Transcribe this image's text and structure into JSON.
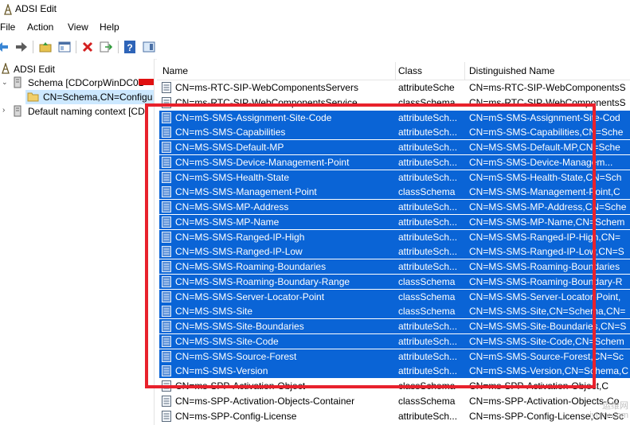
{
  "window": {
    "title": "ADSI Edit"
  },
  "menu": {
    "items": [
      "File",
      "Action",
      "View",
      "Help"
    ]
  },
  "tree": {
    "root": "ADSI Edit",
    "schema": "Schema [CDCorpWinDC01",
    "schema_child": "CN=Schema,CN=Configu",
    "default_context": "Default naming context [CD"
  },
  "list": {
    "columns": [
      "Name",
      "Class",
      "Distinguished Name"
    ],
    "rows": [
      {
        "name": "CN=ms-RTC-SIP-WebComponentsServers",
        "class": "attributeSche",
        "dn": "CN=ms-RTC-SIP-WebComponentsS"
      },
      {
        "name": "CN=ms-RTC-SIP-WebComponentsService",
        "class": "classSchema",
        "dn": "CN=ms-RTC-SIP-WebComponentsS"
      },
      {
        "name": "CN=mS-SMS-Assignment-Site-Code",
        "class": "attributeSch...",
        "dn": "CN=mS-SMS-Assignment-Site-Cod"
      },
      {
        "name": "CN=mS-SMS-Capabilities",
        "class": "attributeSch...",
        "dn": "CN=mS-SMS-Capabilities,CN=Sche"
      },
      {
        "name": "CN=MS-SMS-Default-MP",
        "class": "attributeSch...",
        "dn": "CN=MS-SMS-Default-MP,CN=Sche"
      },
      {
        "name": "CN=mS-SMS-Device-Management-Point",
        "class": "attributeSch...",
        "dn": "CN=mS-SMS-Device-Managem..."
      },
      {
        "name": "CN=mS-SMS-Health-State",
        "class": "attributeSch...",
        "dn": "CN=mS-SMS-Health-State,CN=Sch"
      },
      {
        "name": "CN=MS-SMS-Management-Point",
        "class": "classSchema",
        "dn": "CN=MS-SMS-Management-Point,C"
      },
      {
        "name": "CN=MS-SMS-MP-Address",
        "class": "attributeSch...",
        "dn": "CN=MS-SMS-MP-Address,CN=Sche"
      },
      {
        "name": "CN=MS-SMS-MP-Name",
        "class": "attributeSch...",
        "dn": "CN=MS-SMS-MP-Name,CN=Schem"
      },
      {
        "name": "CN=MS-SMS-Ranged-IP-High",
        "class": "attributeSch...",
        "dn": "CN=MS-SMS-Ranged-IP-High,CN="
      },
      {
        "name": "CN=MS-SMS-Ranged-IP-Low",
        "class": "attributeSch...",
        "dn": "CN=MS-SMS-Ranged-IP-Low,CN=S"
      },
      {
        "name": "CN=MS-SMS-Roaming-Boundaries",
        "class": "attributeSch...",
        "dn": "CN=MS-SMS-Roaming-Boundaries"
      },
      {
        "name": "CN=MS-SMS-Roaming-Boundary-Range",
        "class": "classSchema",
        "dn": "CN=MS-SMS-Roaming-Boundary-R"
      },
      {
        "name": "CN=MS-SMS-Server-Locator-Point",
        "class": "classSchema",
        "dn": "CN=MS-SMS-Server-Locator-Point,"
      },
      {
        "name": "CN=MS-SMS-Site",
        "class": "classSchema",
        "dn": "CN=MS-SMS-Site,CN=Schema,CN="
      },
      {
        "name": "CN=MS-SMS-Site-Boundaries",
        "class": "attributeSch...",
        "dn": "CN=MS-SMS-Site-Boundaries,CN=S"
      },
      {
        "name": "CN=MS-SMS-Site-Code",
        "class": "attributeSch...",
        "dn": "CN=MS-SMS-Site-Code,CN=Schem"
      },
      {
        "name": "CN=mS-SMS-Source-Forest",
        "class": "attributeSch...",
        "dn": "CN=mS-SMS-Source-Forest,CN=Sc"
      },
      {
        "name": "CN=mS-SMS-Version",
        "class": "attributeSch...",
        "dn": "CN=mS-SMS-Version,CN=Schema,C"
      },
      {
        "name": "CN=ms-SPP-Activation-Object",
        "class": "classSchema",
        "dn": "CN=ms-SPP-Activation-Object,C"
      },
      {
        "name": "CN=ms-SPP-Activation-Objects-Container",
        "class": "classSchema",
        "dn": "CN=ms-SPP-Activation-Objects-Co"
      },
      {
        "name": "CN=ms-SPP-Config-License",
        "class": "attributeSch...",
        "dn": "CN=ms-SPP-Config-License,CN=Sc"
      }
    ],
    "selected_rows": [
      2,
      3,
      4,
      5,
      6,
      7,
      8,
      9,
      10,
      11,
      12,
      13,
      14,
      15,
      16,
      17,
      18,
      19
    ]
  },
  "watermark": {
    "line1": "运维网",
    "line2": "iyunv.com"
  },
  "colors": {
    "selection": "#0a64d6",
    "highlight_border": "#e8212c",
    "tree_selection": "#cce8ff"
  }
}
